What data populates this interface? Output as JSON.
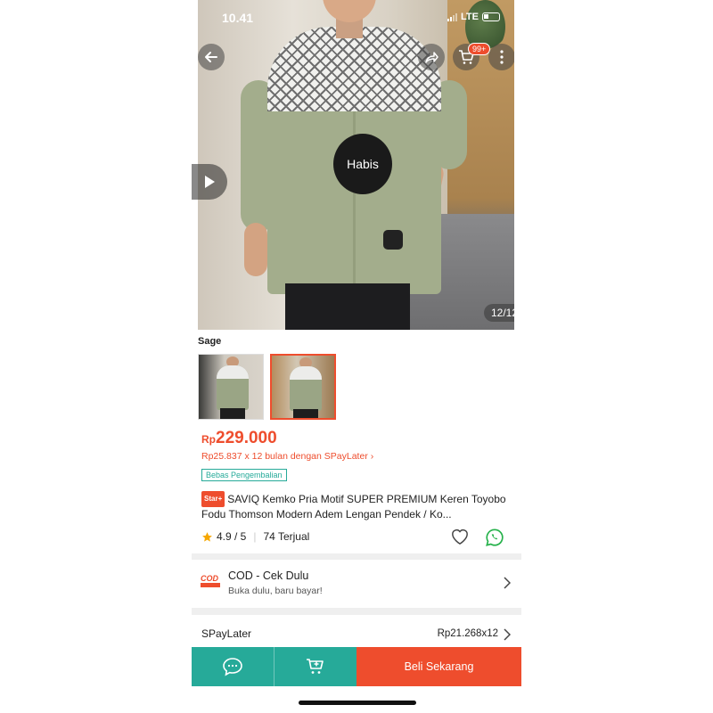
{
  "status_bar": {
    "time": "10.41",
    "network": "LTE"
  },
  "header": {
    "cart_badge": "99+"
  },
  "gallery": {
    "overlay_text": "Habis",
    "counter": "12/12"
  },
  "variant": {
    "label": "Sage"
  },
  "price": {
    "currency": "Rp",
    "amount": "229.000",
    "installment": "Rp25.837 x 12 bulan dengan SPayLater ›"
  },
  "tags": {
    "return": "Bebas Pengembalian"
  },
  "product": {
    "badge": "Star+",
    "title": "SAVIQ Kemko Pria Motif SUPER PREMIUM Keren Toyobo Fodu Thomson Modern Adem Lengan Pendek / Ko..."
  },
  "rating": {
    "score": "4.9 / 5",
    "sold": "74 Terjual"
  },
  "cod": {
    "logo_text": "COD",
    "title": "COD - Cek Dulu",
    "subtitle": "Buka dulu, baru bayar!"
  },
  "spaylater": {
    "label": "SPayLater",
    "value": "Rp21.268x12"
  },
  "bottom_bar": {
    "buy_label": "Beli Sekarang"
  },
  "colors": {
    "accent": "#ee4d2d",
    "teal": "#26aa99"
  }
}
